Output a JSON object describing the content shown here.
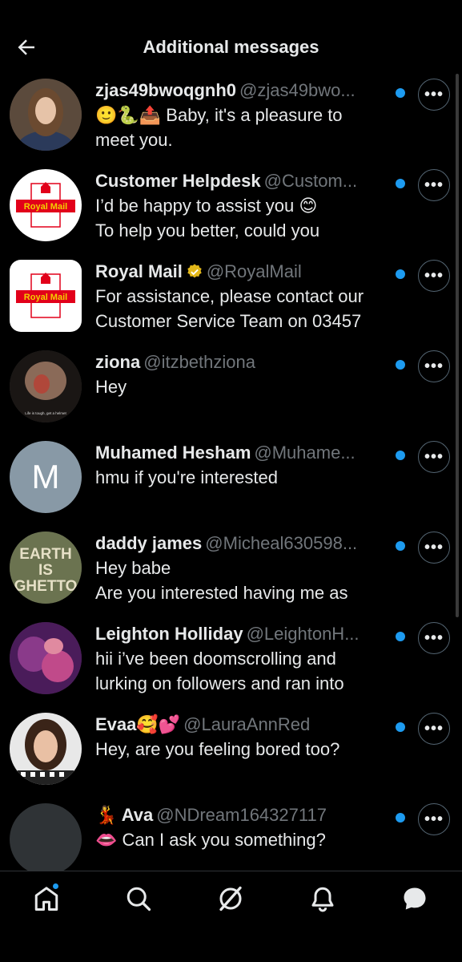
{
  "header": {
    "title": "Additional messages",
    "back_icon": "arrow-left-icon"
  },
  "conversations": [
    {
      "name": "zjas49bwoqgnh0",
      "handle": "@zjas49bwo...",
      "line1": "🙂🐍📤 Baby, it's a pleasure to",
      "line2": "meet you.",
      "avatar": "photo"
    },
    {
      "name": "Customer Helpdesk",
      "handle": "@Custom...",
      "line1": "I’d be happy to assist you 😊",
      "line2": "To help you better, could you",
      "avatar": "royal-mail-logo"
    },
    {
      "name": "Royal Mail",
      "handle": "@RoyalMail",
      "line1": "For assistance, please contact our",
      "line2": "Customer Service Team on 03457",
      "avatar": "royal-mail-logo",
      "verified": true
    },
    {
      "name": "ziona",
      "handle": "@itzbethziona",
      "line1": "Hey",
      "line2": "",
      "avatar": "photo",
      "avatar_caption": "Life is tough, get a helmet"
    },
    {
      "name": "Muhamed Hesham",
      "handle": "@Muhame...",
      "line1": "hmu if you're interested",
      "line2": "",
      "avatar": "letter",
      "avatar_letter": "M"
    },
    {
      "name": "daddy james",
      "handle": "@Micheal630598...",
      "line1": "Hey babe",
      "line2": "Are you interested having me as",
      "avatar": "photo",
      "avatar_text": "EARTH IS GHETTO"
    },
    {
      "name": "Leighton Holliday",
      "handle": "@LeightonH...",
      "line1": "hii i’ve been doomscrolling and",
      "line2": "lurking on followers and ran into",
      "avatar": "photo"
    },
    {
      "name": "Evaa🥰💕",
      "handle": "@LauraAnnRed",
      "line1": "Hey, are you feeling bored too?",
      "line2": "",
      "avatar": "photo"
    },
    {
      "name": "💃 Ava",
      "handle": "@NDream164327117",
      "line1": "👄 Can I ask you something?",
      "line2": "",
      "avatar": "blank"
    }
  ],
  "more_label": "•••",
  "royal_mail_label": "Royal Mail",
  "nav": [
    "home-icon",
    "search-icon",
    "grok-icon",
    "notifications-icon",
    "messages-icon"
  ],
  "colors": {
    "accent": "#1d9bf0",
    "background": "#000000",
    "handle": "#71767b",
    "royal_mail_red": "#e2001a",
    "verified_gold": "#e2b719"
  }
}
